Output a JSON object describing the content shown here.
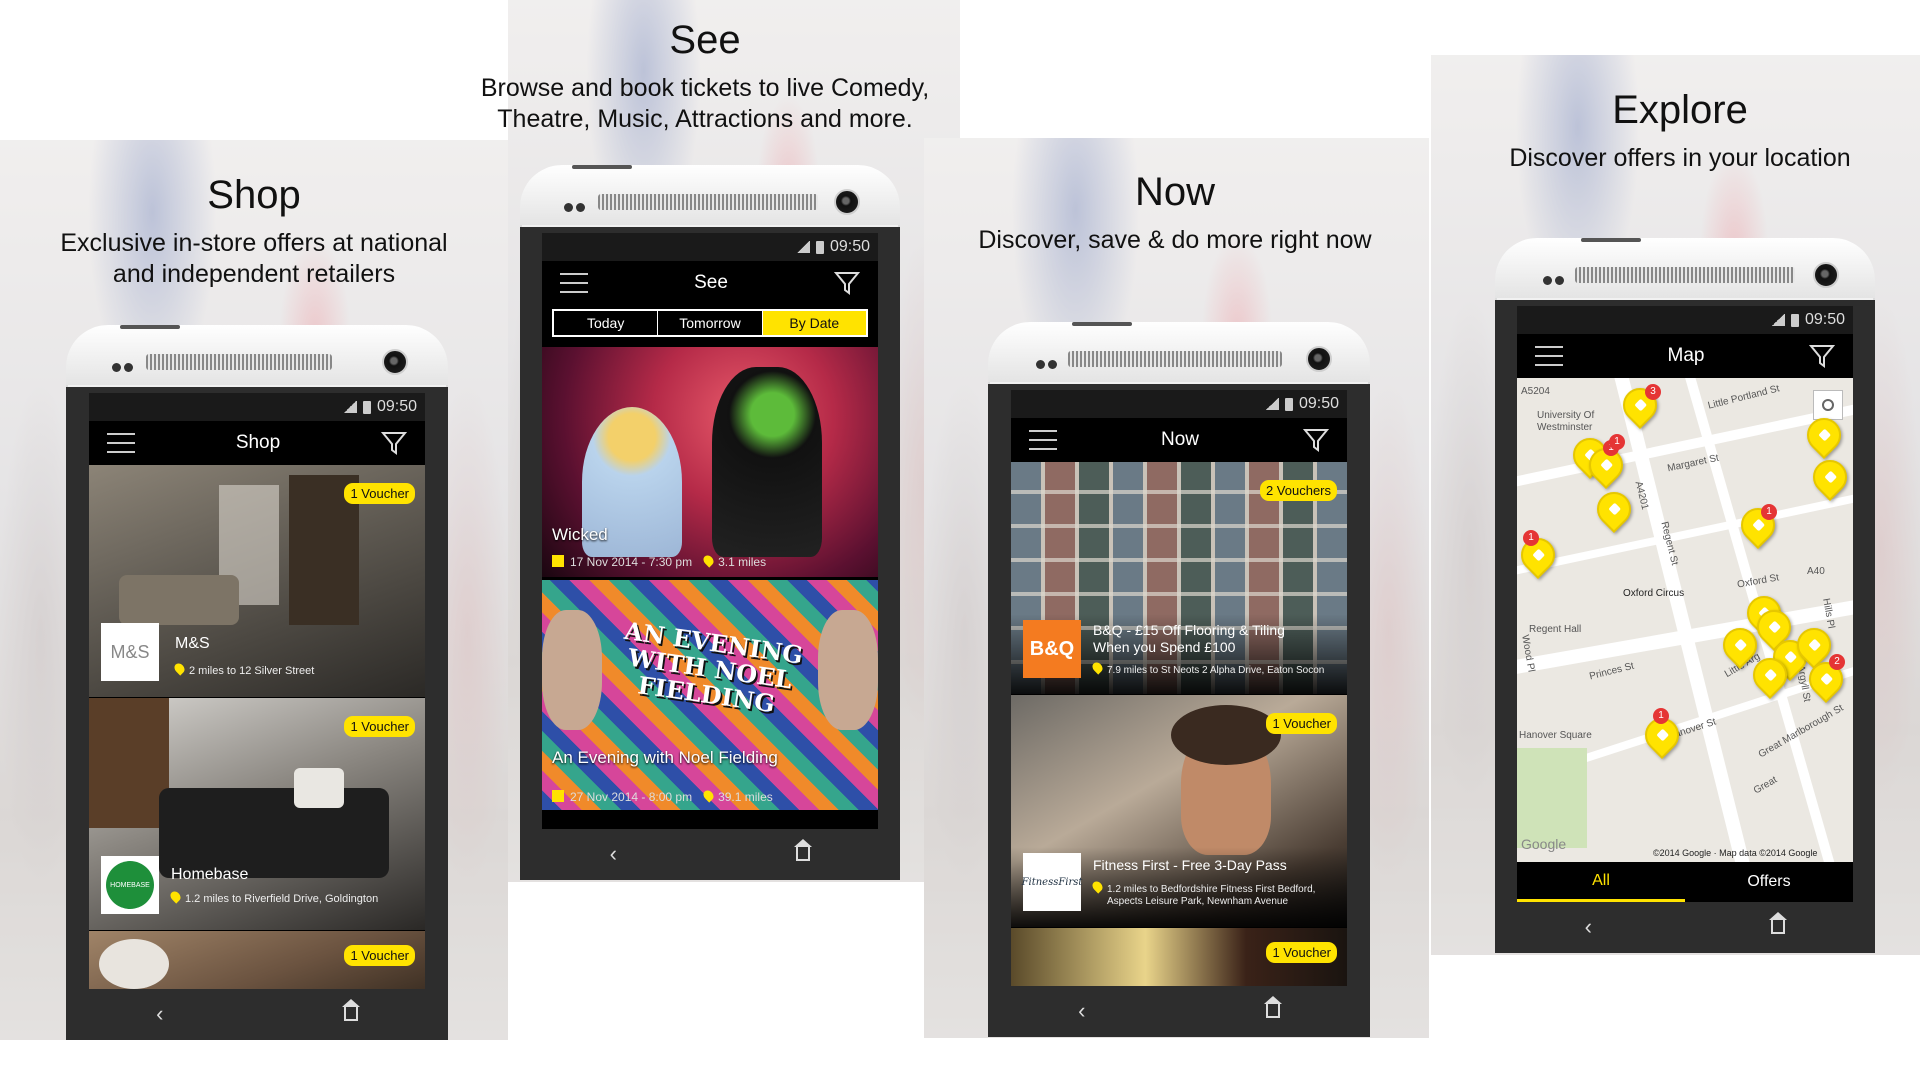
{
  "status_time": "09:50",
  "panels": {
    "shop": {
      "heading": "Shop",
      "subtitle_line1": "Exclusive in-store offers at national",
      "subtitle_line2": "and independent retailers",
      "app_title": "Shop",
      "cards": [
        {
          "name": "M&S",
          "address": "2 miles to 12 Silver Street",
          "voucher": "1 Voucher",
          "brand": "M&S"
        },
        {
          "name": "Homebase",
          "address": "1.2 miles to Riverfield Drive, Goldington",
          "voucher": "1 Voucher",
          "brand": "HOMEBASE"
        },
        {
          "voucher": "1 Voucher"
        }
      ]
    },
    "see": {
      "heading": "See",
      "subtitle_line1": "Browse and book tickets to live Comedy,",
      "subtitle_line2": "Theatre, Music, Attractions and more.",
      "app_title": "See",
      "tabs": [
        "Today",
        "Tomorrow",
        "By Date"
      ],
      "active_tab": "By Date",
      "events": [
        {
          "title": "Wicked",
          "date": "17 Nov 2014 - 7:30 pm",
          "distance": "3.1 miles"
        },
        {
          "title": "An Evening with Noel Fielding",
          "date": "27 Nov 2014 - 8:00 pm",
          "distance": "39.1 miles",
          "poster": "AN EVENING WITH NOEL FIELDING"
        }
      ]
    },
    "now": {
      "heading": "Now",
      "subtitle": "Discover, save & do more right now",
      "app_title": "Now",
      "cards": [
        {
          "name_line1": "B&Q - £15 Off Flooring & Tiling",
          "name_line2": "When you Spend £100",
          "address": "7.9 miles to St Neots 2 Alpha Drive, Eaton Socon",
          "voucher": "2 Vouchers",
          "brand": "B&Q"
        },
        {
          "name": "Fitness First - Free 3-Day Pass",
          "address_line1": "1.2 miles to Bedfordshire Fitness First Bedford,",
          "address_line2": "Aspects Leisure Park, Newnham Avenue",
          "voucher": "1 Voucher",
          "brand": "FitnessFirst"
        },
        {
          "voucher": "1 Voucher"
        }
      ]
    },
    "explore": {
      "heading": "Explore",
      "subtitle": "Discover offers in your location",
      "app_title": "Map",
      "bottom_tabs": [
        "All",
        "Offers"
      ],
      "active_tab": "All",
      "map_labels": {
        "a5204": "A5204",
        "uni1": "University Of",
        "uni2": "Westminster",
        "portland": "Little Portland St",
        "margaret": "Margaret St",
        "a4201": "A4201",
        "regent": "Regent St",
        "oxford": "Oxford St",
        "a40": "A40",
        "oxford_circus": "Oxford Circus",
        "hills": "Hills Pl",
        "regent_hall": "Regent Hall",
        "princes": "Princes St",
        "hanover_sq": "Hanover Square",
        "hanover_st": "Hanover St",
        "argyll": "Argyll St",
        "great_marl": "Great Marlborough St",
        "little_arg": "Little Arg",
        "great": "Great",
        "wood": "Wood Pl",
        "google": "Google",
        "copyright": "©2014 Google · Map data ©2014 Google"
      },
      "badges": [
        "3",
        "1",
        "1",
        "1",
        "1",
        "2",
        "1"
      ]
    }
  },
  "colors": {
    "accent": "#ffe300",
    "appbar": "#000000",
    "phone_body": "#2d2d2d"
  }
}
